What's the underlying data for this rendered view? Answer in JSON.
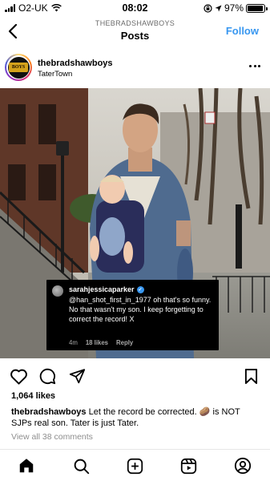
{
  "status_bar": {
    "carrier": "O2-UK",
    "time": "08:02",
    "battery": "97%",
    "battery_level": 0.97
  },
  "header": {
    "username": "THEBRADSHAWBOYS",
    "title": "Posts",
    "follow_label": "Follow"
  },
  "post": {
    "username": "thebradshawboys",
    "location": "TaterTown",
    "avatar_text": "BOYS",
    "likes": "1,064 likes",
    "caption_user": "thebradshawboys",
    "caption_text": "Let the record be corrected. 🥔 is NOT SJPs real son. Tater is just Tater.",
    "view_comments": "View all 38 comments"
  },
  "embedded_comment": {
    "username": "sarahjessicaparker",
    "text": "@han_shot_first_in_1977 oh that's so funny. No that wasn't my son. I keep forgetting to correct the record! X",
    "time": "4m",
    "likes": "18 likes",
    "reply": "Reply"
  },
  "icons": {
    "back": "chevron-left-icon",
    "more": "more-horizontal-icon",
    "like": "heart-icon",
    "comment": "comment-icon",
    "share": "send-icon",
    "save": "bookmark-icon",
    "nav": [
      "home-icon",
      "search-icon",
      "create-icon",
      "reels-icon",
      "profile-icon"
    ]
  },
  "colors": {
    "accent": "#3897f0",
    "muted": "#8e8e8e"
  }
}
